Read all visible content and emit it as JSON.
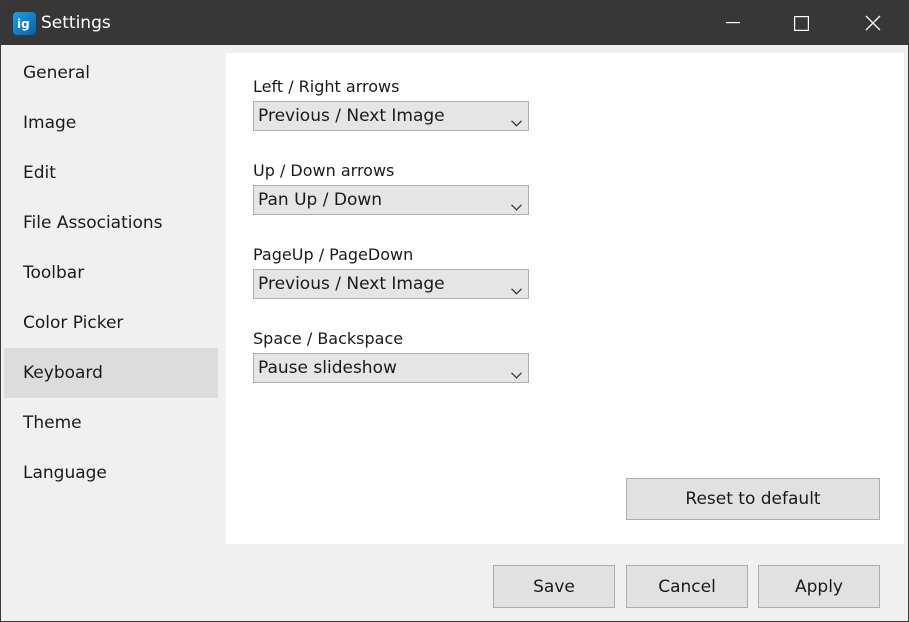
{
  "window": {
    "title": "Settings",
    "app_icon": "imageglass-logo-icon",
    "controls": [
      "minimize-icon",
      "maximize-icon",
      "close-icon"
    ]
  },
  "sidebar": {
    "selected": "Keyboard",
    "items": [
      {
        "label": "General"
      },
      {
        "label": "Image"
      },
      {
        "label": "Edit"
      },
      {
        "label": "File Associations"
      },
      {
        "label": "Toolbar"
      },
      {
        "label": "Color Picker"
      },
      {
        "label": "Keyboard"
      },
      {
        "label": "Theme"
      },
      {
        "label": "Language"
      }
    ]
  },
  "keyboard": {
    "settings": [
      {
        "label": "Left / Right arrows",
        "value": "Previous / Next Image"
      },
      {
        "label": "Up / Down arrows",
        "value": "Pan Up / Down"
      },
      {
        "label": "PageUp / PageDown",
        "value": "Previous / Next Image"
      },
      {
        "label": "Space / Backspace",
        "value": "Pause slideshow"
      }
    ],
    "reset_label": "Reset to default"
  },
  "footer": {
    "save_label": "Save",
    "cancel_label": "Cancel",
    "apply_label": "Apply"
  },
  "colors": {
    "titlebar": "#373737",
    "selected_item": "#dcdcdc",
    "button_face": "#e1e1e1",
    "combo_face": "#e5e5e5"
  }
}
